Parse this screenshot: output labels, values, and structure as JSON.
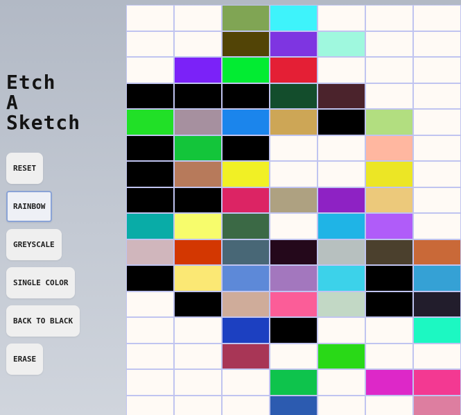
{
  "app": {
    "title_lines": [
      "Etch",
      "A",
      "Sketch"
    ]
  },
  "controls": [
    {
      "id": "reset",
      "label": "RESET",
      "active": false
    },
    {
      "id": "rainbow",
      "label": "RAINBOW",
      "active": true
    },
    {
      "id": "greyscale",
      "label": "GREYSCALE",
      "active": false
    },
    {
      "id": "single-color",
      "label": "SINGLE COLOR",
      "active": false
    },
    {
      "id": "back-to-black",
      "label": "BACK TO BLACK",
      "active": false
    },
    {
      "id": "erase",
      "label": "ERASE",
      "active": false
    }
  ],
  "colors": {
    "empty": "#fffaf5",
    "gridline": "#c0c4f0"
  },
  "grid": {
    "columns": 7,
    "cells": [
      [
        "#fffaf5",
        "#fffaf5",
        "#80a554",
        "#3ef3fb",
        "#fffaf5",
        "#fffaf5",
        "#fffaf5"
      ],
      [
        "#fffaf5",
        "#fffaf5",
        "#524406",
        "#7e35e1",
        "#9ff8de",
        "#fffaf5",
        "#fffaf5"
      ],
      [
        "#fffaf5",
        "#7b22f8",
        "#02ec32",
        "#e41f35",
        "#fffaf5",
        "#fffaf5",
        "#fffaf5"
      ],
      [
        "#000000",
        "#000000",
        "#000000",
        "#134d2c",
        "#4b232c",
        "#fffaf5",
        "#fffaf5"
      ],
      [
        "#21e027",
        "#a6909f",
        "#1b85ec",
        "#cda656",
        "#000000",
        "#b2de80",
        "#fffaf5"
      ],
      [
        "#000000",
        "#13c53a",
        "#000000",
        "#fffaf5",
        "#fffaf5",
        "#ffb7a0",
        "#fffaf5"
      ],
      [
        "#000000",
        "#b77a5b",
        "#f1f025",
        "#fffaf5",
        "#fffaf5",
        "#ece625",
        "#fffaf5"
      ],
      [
        "#000000",
        "#000000",
        "#dc2464",
        "#aea181",
        "#8e22c4",
        "#ecc97b",
        "#fffaf5"
      ],
      [
        "#09aca7",
        "#f7fc6c",
        "#3b6945",
        "#fffaf5",
        "#1fb4e6",
        "#b05cf9",
        "#fffaf5"
      ],
      [
        "#d0b6bc",
        "#d33701",
        "#486776",
        "#24081b",
        "#b7c0bf",
        "#4b402d",
        "#c96938"
      ],
      [
        "#000000",
        "#fbe874",
        "#5d89d8",
        "#a377be",
        "#3cd2ea",
        "#000000",
        "#35a1d5"
      ],
      [
        "#fffaf5",
        "#000000",
        "#cfac9a",
        "#fb5d98",
        "#c2d8c5",
        "#000000",
        "#221d2c"
      ],
      [
        "#fffaf5",
        "#fffaf5",
        "#1c40c1",
        "#000000",
        "#fffaf5",
        "#fffaf5",
        "#1cf8c2"
      ],
      [
        "#fffaf5",
        "#fffaf5",
        "#a83656",
        "#fffaf5",
        "#29d917",
        "#fffaf5",
        "#fffaf5"
      ],
      [
        "#fffaf5",
        "#fffaf5",
        "#fffaf5",
        "#0ec34c",
        "#fffaf5",
        "#dd28c8",
        "#f33992"
      ],
      [
        "#fffaf5",
        "#fffaf5",
        "#fffaf5",
        "#2c5bb0",
        "#fffaf5",
        "#fffaf5",
        "#dd7ea0"
      ]
    ]
  }
}
